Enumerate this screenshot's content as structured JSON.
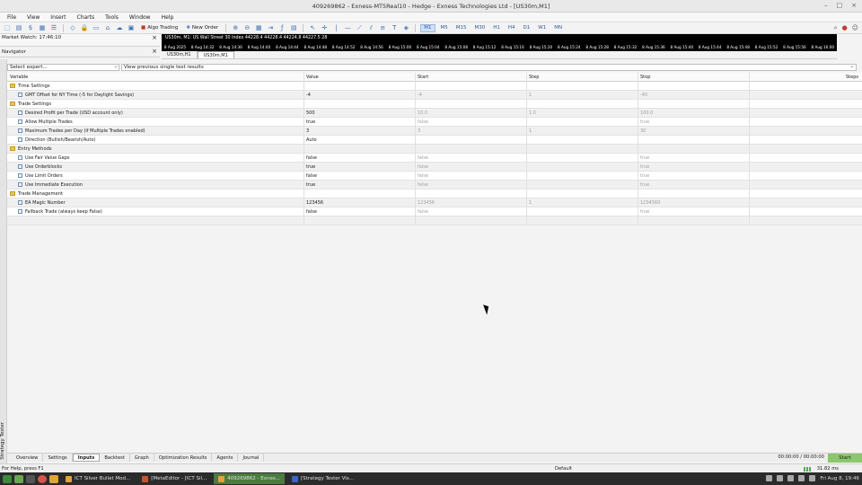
{
  "window": {
    "title": "409269862 - Exness-MT5Real10 - Hedge - Exness Technologies Ltd - [US30m,M1]"
  },
  "menu": [
    {
      "label": "File"
    },
    {
      "label": "View"
    },
    {
      "label": "Insert"
    },
    {
      "label": "Charts"
    },
    {
      "label": "Tools"
    },
    {
      "label": "Window"
    },
    {
      "label": "Help"
    }
  ],
  "toolbar": {
    "algo_trading": "Algo Trading",
    "new_order": "New Order",
    "timeframes": [
      "M1",
      "M5",
      "M15",
      "M30",
      "H1",
      "H4",
      "D1",
      "W1",
      "MN"
    ],
    "active_timeframe": "M1"
  },
  "market_watch": {
    "label": "Market Watch: 17:46:10"
  },
  "navigator": {
    "label": "Navigator"
  },
  "chart": {
    "info": "US30m, M1:  US Wall Street 30 Index  44228.4 44228.4 44224.8 44227.5  28",
    "time_labels": [
      "8 Aug 2025",
      "8 Aug 14:32",
      "8 Aug 14:36",
      "8 Aug 14:40",
      "8 Aug 14:44",
      "8 Aug 14:48",
      "8 Aug 14:52",
      "8 Aug 14:56",
      "8 Aug 15:00",
      "8 Aug 15:04",
      "8 Aug 15:08",
      "8 Aug 15:12",
      "8 Aug 15:16",
      "8 Aug 15:20",
      "8 Aug 15:24",
      "8 Aug 15:28",
      "8 Aug 15:32",
      "8 Aug 15:36",
      "8 Aug 15:40",
      "8 Aug 15:44",
      "8 Aug 15:48",
      "8 Aug 15:52",
      "8 Aug 15:56",
      "8 Aug 16:00"
    ],
    "tabs": [
      {
        "label": "US30m,H1"
      },
      {
        "label": "US30m,M1"
      }
    ]
  },
  "tester": {
    "side_label": "Strategy Tester",
    "expert_select": "Select expert...",
    "view_select": "View previous single test results",
    "columns": {
      "variable": "Variable",
      "value": "Value",
      "start": "Start",
      "step": "Step",
      "stop": "Stop",
      "steps": "Steps"
    },
    "rows": [
      {
        "type": "cat",
        "variable": "Time Settings"
      },
      {
        "type": "param",
        "variable": "GMT Offset for NY Time (-5 for Daylight Savings)",
        "value": "-4",
        "start": "-4",
        "step": "1",
        "stop": "-40"
      },
      {
        "type": "cat",
        "variable": "Trade Settings"
      },
      {
        "type": "param",
        "variable": "Desired Profit per Trade (USD account only)",
        "value": "500",
        "start": "10.0",
        "step": "1.0",
        "stop": "100.0"
      },
      {
        "type": "param",
        "variable": "Allow Multiple Trades",
        "value": "true",
        "start": "false",
        "step": "",
        "stop": "true"
      },
      {
        "type": "param",
        "variable": "Maximum Trades per Day (if Multiple Trades enabled)",
        "value": "3",
        "start": "3",
        "step": "1",
        "stop": "30"
      },
      {
        "type": "param",
        "variable": "Direction (Bullish/Bearish/Auto)",
        "value": "Auto",
        "start": "",
        "step": "",
        "stop": ""
      },
      {
        "type": "cat",
        "variable": "Entry Methods"
      },
      {
        "type": "param",
        "variable": "Use Fair Value Gaps",
        "value": "false",
        "start": "false",
        "step": "",
        "stop": "true"
      },
      {
        "type": "param",
        "variable": "Use Orderblocks",
        "value": "true",
        "start": "false",
        "step": "",
        "stop": "true"
      },
      {
        "type": "param",
        "variable": "Use Limit Orders",
        "value": "false",
        "start": "false",
        "step": "",
        "stop": "true"
      },
      {
        "type": "param",
        "variable": "Use Immediate Execution",
        "value": "true",
        "start": "false",
        "step": "",
        "stop": "true"
      },
      {
        "type": "cat",
        "variable": "Trade Management"
      },
      {
        "type": "param",
        "variable": "EA Magic Number",
        "value": "123456",
        "start": "123456",
        "step": "1",
        "stop": "1234560"
      },
      {
        "type": "param",
        "variable": "Fallback Trade (always keep False)",
        "value": "false",
        "start": "false",
        "step": "",
        "stop": "true"
      }
    ],
    "bottom_tabs": [
      {
        "label": "Overview"
      },
      {
        "label": "Settings"
      },
      {
        "label": "Inputs"
      },
      {
        "label": "Backtest"
      },
      {
        "label": "Graph"
      },
      {
        "label": "Optimization Results"
      },
      {
        "label": "Agents"
      },
      {
        "label": "Journal"
      }
    ],
    "active_bottom_tab": "Inputs",
    "timer": "00:00:00 / 00:00:00",
    "start_button": "Start"
  },
  "status": {
    "help": "For Help, press F1",
    "profile": "Default",
    "ping": "31.82 ms"
  },
  "taskbar": {
    "apps": [
      {
        "label": "ICT Silver Bullet Mod...",
        "color": "#e2a33a"
      },
      {
        "label": "[MetaEditor - [ICT Sil...",
        "color": "#c8542e"
      },
      {
        "label": "409269862 - Exnes...",
        "color": "#e2a33a"
      },
      {
        "label": "[Strategy Tester Vis...",
        "color": "#3a66c2"
      }
    ],
    "active_index": 2,
    "clock": "Fri Aug 8, 19:46"
  }
}
